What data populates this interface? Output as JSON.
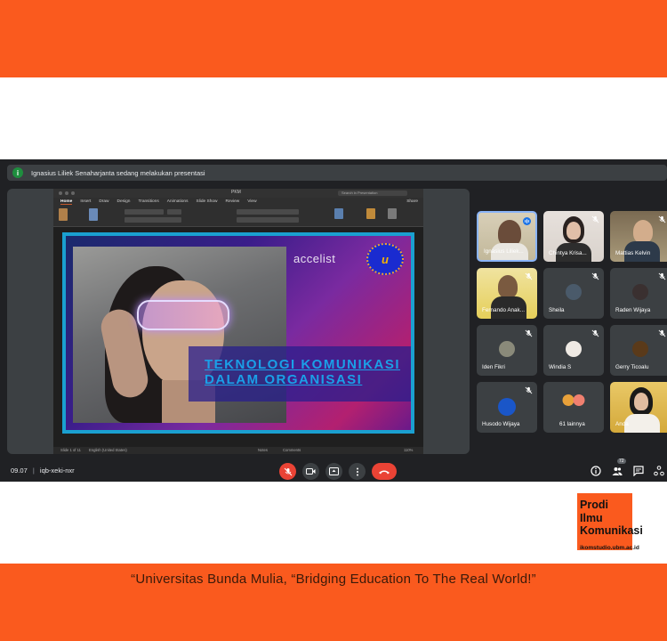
{
  "colors": {
    "brand_orange": "#FA5A1E",
    "meet_bg": "#202124",
    "tile_bg": "#3C4043",
    "end_call_red": "#EA4335",
    "active_speaker_blue": "#8AB4F8"
  },
  "banner": {
    "icon": "info-icon",
    "initial": "i",
    "text": "Ignasius Liliek Senaharjanta sedang melakukan presentasi"
  },
  "presentation": {
    "file_name": "PKM",
    "search_placeholder": "Search in Presentation",
    "share_label": "Share",
    "tabs": [
      "Home",
      "Insert",
      "Draw",
      "Design",
      "Transitions",
      "Animations",
      "Slide Show",
      "Review",
      "View"
    ],
    "slide": {
      "brand": "accelist",
      "logo_text": "u",
      "title_line1": "TEKNOLOGI KOMUNIKASI",
      "title_line2": "DALAM ORGANISASI"
    },
    "status": {
      "slide_count": "Slide 1 of 11",
      "language": "English (United States)",
      "notes": "Notes",
      "comments": "Comments",
      "zoom": "110%"
    }
  },
  "participants": [
    {
      "name": "Ignasius Liliek...",
      "muted": false,
      "video": true
    },
    {
      "name": "Chintya Krisa...",
      "muted": true,
      "video": true
    },
    {
      "name": "Mattias Kelvin",
      "muted": true,
      "video": true
    },
    {
      "name": "Fernando Anak...",
      "muted": true,
      "video": true
    },
    {
      "name": "Sheila",
      "muted": true,
      "video": false
    },
    {
      "name": "Raden Wijaya",
      "muted": true,
      "video": false
    },
    {
      "name": "Iden Fikri",
      "muted": true,
      "video": false
    },
    {
      "name": "Windia S",
      "muted": true,
      "video": false
    },
    {
      "name": "Gerry Ticoalu",
      "muted": true,
      "video": false
    },
    {
      "name": "Husodo Wijaya",
      "muted": true,
      "video": false
    },
    {
      "name": "61 lainnya",
      "muted": false,
      "video": false
    },
    {
      "name": "Anda",
      "muted": false,
      "video": true
    }
  ],
  "bottom_bar": {
    "time": "09.07",
    "separator": "|",
    "meeting_code": "iqb-xeki-nxr",
    "participant_count": "72"
  },
  "prodi": {
    "line1": "Prodi",
    "line2": "Ilmu",
    "line3": "Komunikasi",
    "url": "ikomstudio.ubm.ac.id"
  },
  "tagline": "“Universitas Bunda Mulia, “Bridging Education To The Real World!”"
}
